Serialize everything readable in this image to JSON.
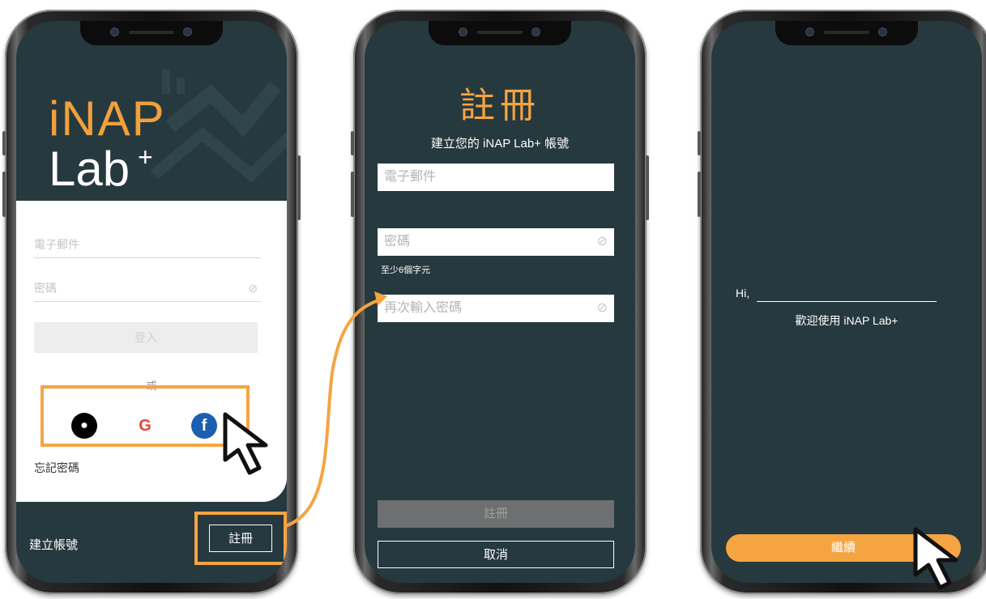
{
  "screen1": {
    "logo_top": "iNAP",
    "logo_bottom": "Lab",
    "logo_plus": "+",
    "email_placeholder": "電子郵件",
    "password_placeholder": "密碼",
    "login_button": "登入",
    "or_label": "或",
    "social": [
      {
        "name": "Apple",
        "icon": "apple-icon",
        "color": "#000000"
      },
      {
        "name": "Google",
        "icon": "google-icon",
        "color": "#4285f4"
      },
      {
        "name": "Facebook",
        "icon": "facebook-icon",
        "color": "#1c5fb0"
      }
    ],
    "forgot_password": "忘記密碼",
    "create_account": "建立帳號",
    "register_button": "註冊"
  },
  "screen2": {
    "title": "註冊",
    "subtitle": "建立您的 iNAP Lab+ 帳號",
    "email_placeholder": "電子郵件",
    "password_placeholder": "密碼",
    "password_hint": "至少6個字元",
    "confirm_placeholder": "再次輸入密碼",
    "register_button": "註冊",
    "cancel_button": "取消"
  },
  "screen3": {
    "greeting": "Hi,",
    "welcome": "歡迎使用 iNAP Lab+",
    "continue_button": "繼續"
  },
  "colors": {
    "accent": "#f5a442",
    "screen_bg": "#26393f",
    "highlight": "#f5a442"
  }
}
